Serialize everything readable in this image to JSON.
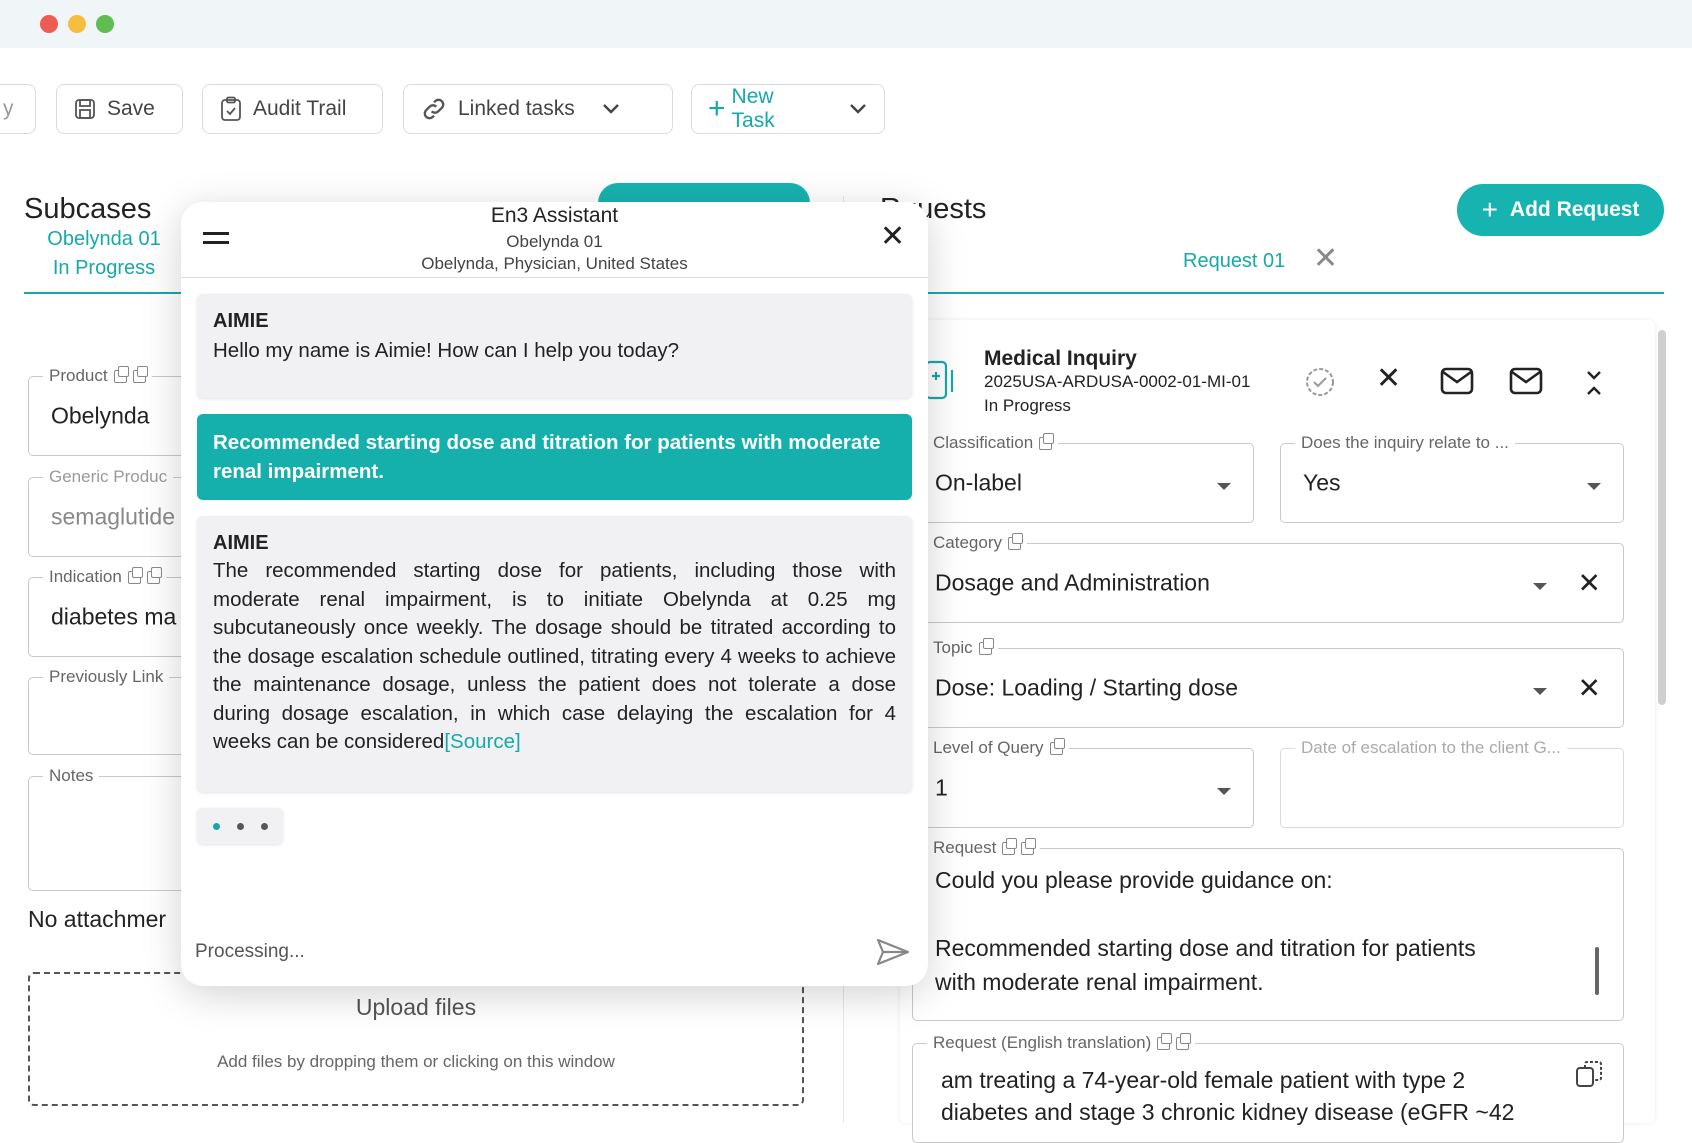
{
  "window": {
    "traffic_lights": [
      "#ee5b52",
      "#f4be3f",
      "#5fbe4f"
    ]
  },
  "toolbar": {
    "partial_label": "y",
    "save_label": "Save",
    "audit_label": "Audit Trail",
    "linked_label": "Linked tasks",
    "new_task_label": "New Task"
  },
  "subcases": {
    "title": "Subcases",
    "tab_name": "Obelynda 01",
    "tab_status": "In Progress",
    "fields": {
      "product_label": "Product",
      "product_value": "Obelynda",
      "generic_label": "Generic Produc",
      "generic_value": "semaglutide",
      "indication_label": "Indication",
      "indication_value": "diabetes ma",
      "linked_label": "Previously Link",
      "notes_label": "Notes"
    },
    "no_attachments": "No attachmer",
    "upload_title": "Upload files",
    "upload_hint": "Add files by dropping them or clicking on this window"
  },
  "requests": {
    "title_partial": "quests",
    "add_request_label": "Add Request",
    "tab_label": "Request 01",
    "card": {
      "title": "Medical Inquiry",
      "id": "2025USA-ARDUSA-0002-01-MI-01",
      "status": "In Progress"
    },
    "fields": {
      "classification_label": "Classification",
      "classification_value": "On-label",
      "relate_label": "Does the inquiry relate to ...",
      "relate_value": "Yes",
      "category_label": "Category",
      "category_value": "Dosage and Administration",
      "topic_label": "Topic",
      "topic_value": "Dose: Loading / Starting dose",
      "level_label": "Level of Query",
      "level_value": "1",
      "escalation_label": "Date of escalation to the client G...",
      "request_label": "Request",
      "request_line1": "Could you please provide guidance on:",
      "request_line2": "Recommended starting dose and titration for patients",
      "request_line3": "with moderate renal impairment.",
      "translation_label": "Request (English translation)",
      "translation_line1": "am treating a 74-year-old female patient with type 2",
      "translation_line2": "diabetes and stage 3 chronic kidney disease (eGFR ~42"
    }
  },
  "assistant": {
    "title": "En3 Assistant",
    "subtitle": "Obelynda 01",
    "context": "Obelynda, Physician, United States",
    "messages": {
      "m1_sender": "AIMIE",
      "m1_text": "Hello my name is Aimie! How can I help you today?",
      "m2_text": "Recommended starting dose and titration for patients with moderate renal impairment.",
      "m3_sender": "AIMIE",
      "m3_text": "The recommended starting dose for patients, including those with moderate renal impairment, is to initiate Obelynda at 0.25 mg subcutaneously once weekly. The dosage should be titrated according to the dosage escalation schedule outlined, titrating every 4 weeks to achieve the maintenance dosage, unless the patient does not tolerate a dose during dosage escalation, in which case delaying the escalation for 4 weeks can be considered",
      "m3_source": "[Source]"
    },
    "input_placeholder": "Processing..."
  },
  "colors": {
    "accent": "#16a9a8",
    "accent_button": "#17b3b0",
    "window_bar": "#f0f6f7"
  }
}
